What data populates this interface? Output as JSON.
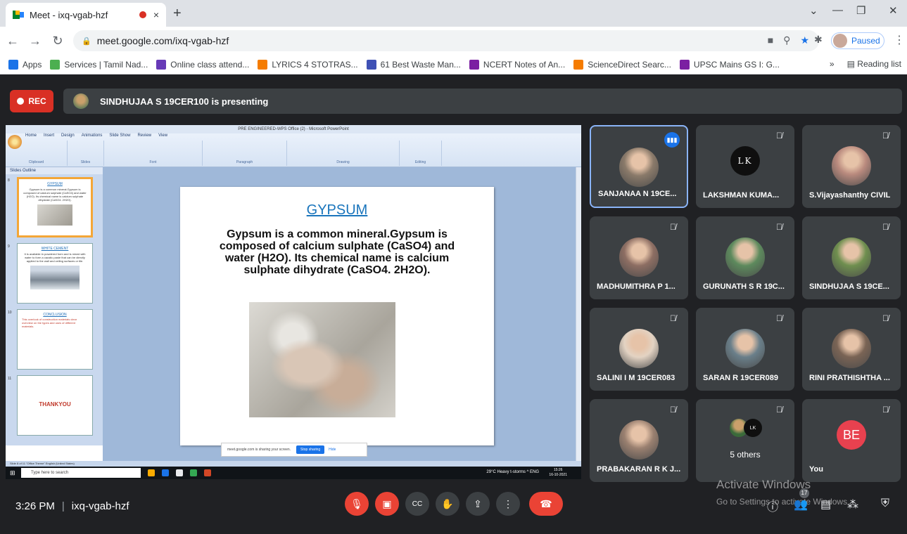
{
  "browser": {
    "tab_title": "Meet - ixq-vgab-hzf",
    "tab_close": "×",
    "new_tab": "+",
    "url": "meet.google.com/ixq-vgab-hzf",
    "profile_status": "Paused",
    "bookmarks": [
      {
        "label": "Apps",
        "color": "#1a73e8"
      },
      {
        "label": "Services | Tamil Nad...",
        "color": "#4caf50"
      },
      {
        "label": "Online class attend...",
        "color": "#673ab7"
      },
      {
        "label": "LYRICS 4 STOTRAS...",
        "color": "#f57c00"
      },
      {
        "label": "61 Best Waste Man...",
        "color": "#3f51b5"
      },
      {
        "label": "NCERT Notes of An...",
        "color": "#7b1fa2"
      },
      {
        "label": "ScienceDirect Searc...",
        "color": "#f57c00"
      },
      {
        "label": "UPSC Mains GS I: G...",
        "color": "#7b1fa2"
      }
    ],
    "bookmarks_more": "»",
    "reading_list": "Reading list"
  },
  "meet": {
    "rec_label": "REC",
    "presenting_text": "SINDHUJAA S 19CER100 is presenting",
    "time": "3:26 PM",
    "separator": "|",
    "meeting_code": "ixq-vgab-hzf",
    "participant_count": "17",
    "watermark_title": "Activate Windows",
    "watermark_sub": "Go to Settings to activate Windows."
  },
  "presentation": {
    "window_title": "PRE ENGINEERED-WPS Office (2) - Microsoft PowerPoint",
    "ribbon_tabs": [
      "Home",
      "Insert",
      "Design",
      "Animations",
      "Slide Show",
      "Review",
      "View"
    ],
    "ribbon_groups": [
      "Clipboard",
      "Slides",
      "Font",
      "Paragraph",
      "Drawing",
      "Editing"
    ],
    "panel_tabs": "Slides   Outline",
    "slide_title": "GYPSUM",
    "slide_text": "Gypsum is a common mineral.Gypsum is composed of calcium sulphate (CaSO4) and water (H2O). Its chemical name is calcium sulphate dihydrate (CaSO4. 2H2O).",
    "thumbs": [
      {
        "num": "8",
        "title": "GYPSUM",
        "text": "Gypsum is a common mineral.Gypsum is composed of calcium sulphate (CaSO4) and water (H2O). Its chemical name is calcium sulphate dihydrate (CaSO4. 2H2O)."
      },
      {
        "num": "9",
        "title": "WHITE CEMENT",
        "text": "It is available in powdered form and is mixed with water to form a caustic paste that can be directly applied to the wall and ceiling surfaces or tile."
      },
      {
        "num": "10",
        "title": "CONCLUSION",
        "text": "This overlook of construction materials clear overview on the types and uses of different materials."
      },
      {
        "num": "11",
        "title": "THANKYOU",
        "text": ""
      }
    ],
    "status_text": "Slide 8 of 11   \"Office Theme\"   English (United States)",
    "share_text": "meet.google.com is sharing your screen.",
    "stop_sharing": "Stop sharing",
    "hide": "Hide",
    "taskbar_search": "Type here to search",
    "taskbar_weather": "29°C Heavy t-storms  ^  ENG",
    "taskbar_time": "15:26",
    "taskbar_date": "16-10-2021"
  },
  "participants": [
    {
      "name": "SANJANAA N 19CE...",
      "avatar_color": "#8a7a6a",
      "speaking": true
    },
    {
      "name": "LAKSHMAN KUMA...",
      "initials": "LK"
    },
    {
      "name": "S.Vijayashanthy CIVIL",
      "avatar_color": "#b98a7e"
    },
    {
      "name": "MADHUMITHRA P 1...",
      "avatar_color": "#8d6e63"
    },
    {
      "name": "GURUNATH S R 19C...",
      "avatar_color": "#5d8a5d"
    },
    {
      "name": "SINDHUJAA S 19CE...",
      "avatar_color": "#6f8f4f"
    },
    {
      "name": "SALINI I M 19CER083",
      "avatar_color": "#e3d3c3"
    },
    {
      "name": "SARAN R 19CER089",
      "avatar_color": "#6a7f8a"
    },
    {
      "name": "RINI PRATHISHTHA ...",
      "avatar_color": "#7a6455"
    },
    {
      "name": "PRABAKARAN R K J...",
      "avatar_color": "#9a8070"
    },
    {
      "name": "5 others",
      "initials": "LK"
    },
    {
      "name": "You",
      "initials": "BE"
    }
  ]
}
